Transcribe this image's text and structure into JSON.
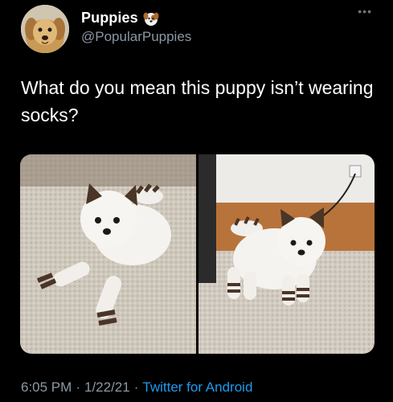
{
  "tweet": {
    "author": {
      "display_name": "Puppies",
      "handle": "@PopularPuppies",
      "badge_icon": "puppy-emoji-icon"
    },
    "more_icon": "more-options-icon",
    "text": "What do you mean this puppy isn’t wearing socks?",
    "media": [
      {
        "icon": "puppy-photo-lying"
      },
      {
        "icon": "puppy-photo-standing"
      }
    ],
    "time": "6:05 PM",
    "separator": "·",
    "date": "1/22/21",
    "source": "Twitter for Android"
  },
  "colors": {
    "background": "#000000",
    "secondary_text": "#8b98a5",
    "link": "#1d9bf0"
  }
}
